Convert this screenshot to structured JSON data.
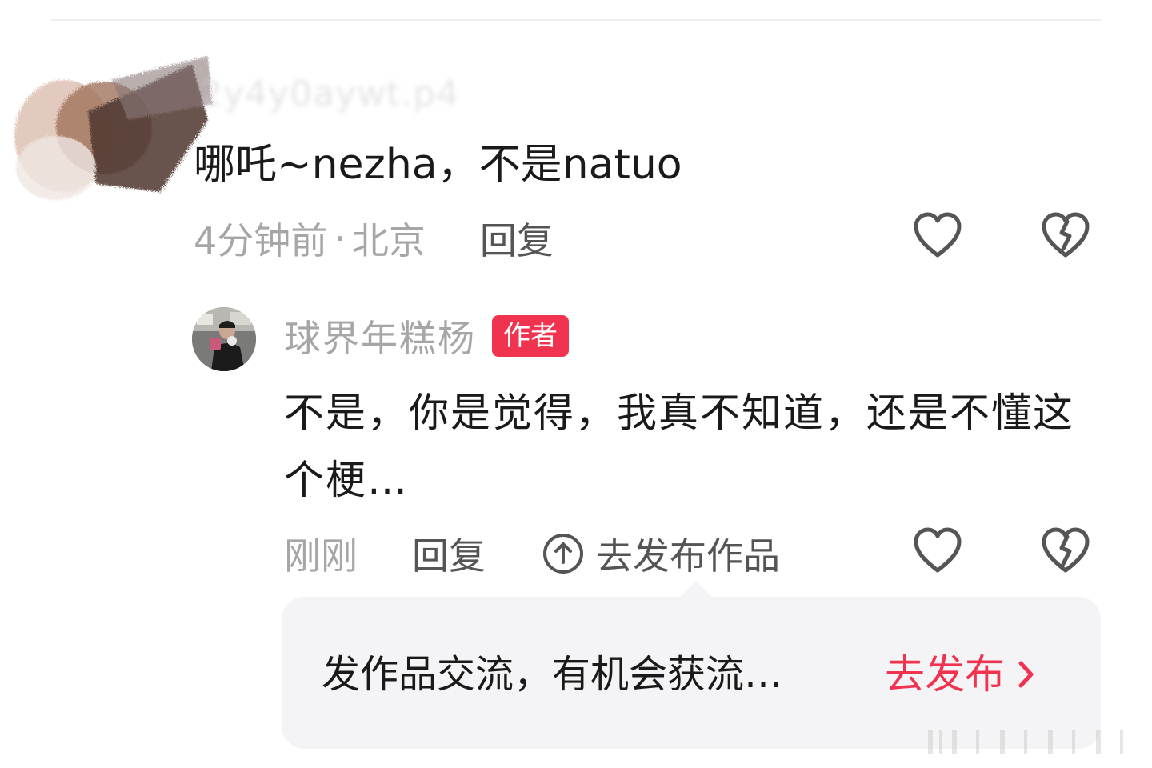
{
  "comment": {
    "username_obscured": "2y4y0aywt.p4",
    "text": "哪吒~nezha，不是natuo",
    "time": "4分钟前",
    "separator": "·",
    "location": "北京",
    "reply_label": "回复"
  },
  "author_reply": {
    "name": "球界年糕杨",
    "badge": "作者",
    "text": "不是，你是觉得，我真不知道，还是不懂这个梗…",
    "time": "刚刚",
    "reply_label": "回复",
    "publish_label": "去发布作品"
  },
  "tooltip": {
    "text": "发作品交流，有机会获流…",
    "cta_label": "去发布"
  },
  "colors": {
    "accent": "#f0344f",
    "text_primary": "#1a1a1a",
    "text_secondary": "#a6a6a6",
    "icon_gray": "#555555",
    "bubble_bg": "#f4f4f6"
  },
  "icons": {
    "like": "heart-outline-icon",
    "dislike": "broken-heart-icon",
    "publish": "arrow-up-circle-icon",
    "cta": "chevron-right-icon"
  }
}
